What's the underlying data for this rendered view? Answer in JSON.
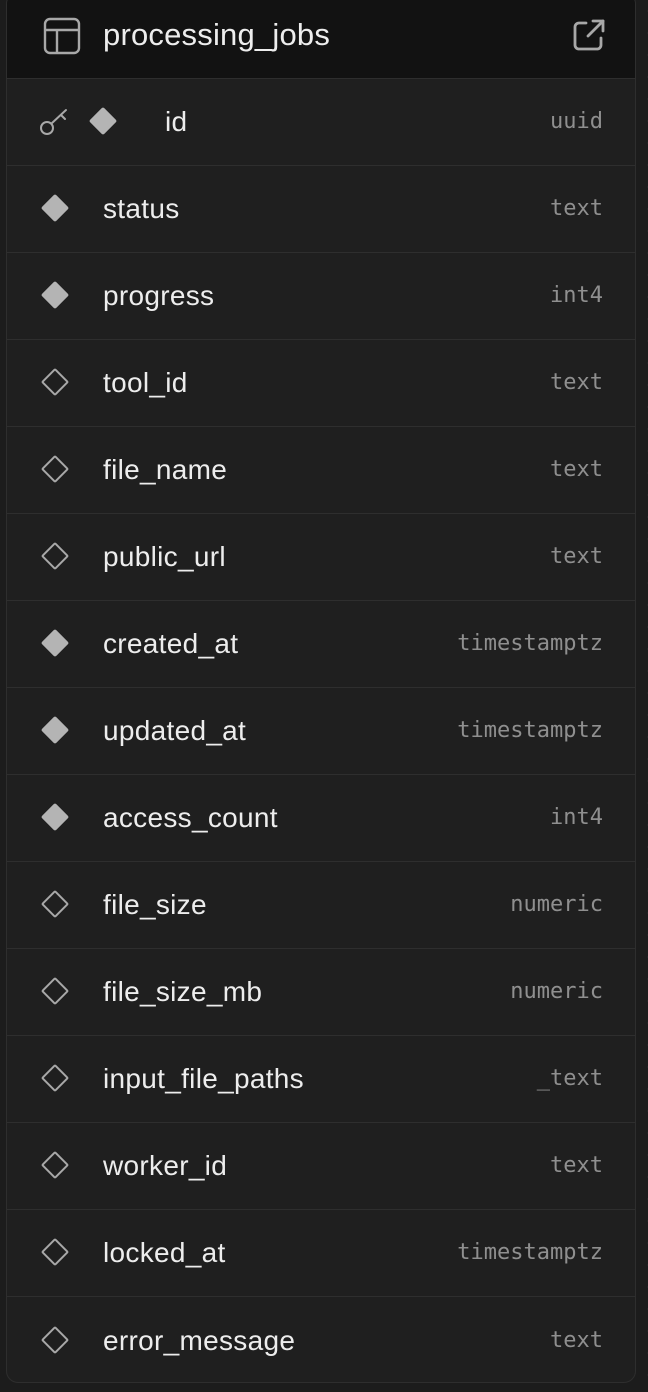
{
  "table": {
    "title": "processing_jobs",
    "icons": {
      "table": "table-icon",
      "open": "external-link-icon",
      "primary_key": "key-icon"
    },
    "columns": [
      {
        "name": "id",
        "type": "uuid",
        "primary_key": true,
        "nullable": false
      },
      {
        "name": "status",
        "type": "text",
        "primary_key": false,
        "nullable": false
      },
      {
        "name": "progress",
        "type": "int4",
        "primary_key": false,
        "nullable": false
      },
      {
        "name": "tool_id",
        "type": "text",
        "primary_key": false,
        "nullable": true
      },
      {
        "name": "file_name",
        "type": "text",
        "primary_key": false,
        "nullable": true
      },
      {
        "name": "public_url",
        "type": "text",
        "primary_key": false,
        "nullable": true
      },
      {
        "name": "created_at",
        "type": "timestamptz",
        "primary_key": false,
        "nullable": false
      },
      {
        "name": "updated_at",
        "type": "timestamptz",
        "primary_key": false,
        "nullable": false
      },
      {
        "name": "access_count",
        "type": "int4",
        "primary_key": false,
        "nullable": false
      },
      {
        "name": "file_size",
        "type": "numeric",
        "primary_key": false,
        "nullable": true
      },
      {
        "name": "file_size_mb",
        "type": "numeric",
        "primary_key": false,
        "nullable": true
      },
      {
        "name": "input_file_paths",
        "type": "_text",
        "primary_key": false,
        "nullable": true
      },
      {
        "name": "worker_id",
        "type": "text",
        "primary_key": false,
        "nullable": true
      },
      {
        "name": "locked_at",
        "type": "timestamptz",
        "primary_key": false,
        "nullable": true
      },
      {
        "name": "error_message",
        "type": "text",
        "primary_key": false,
        "nullable": true
      }
    ]
  },
  "colors": {
    "background": "#1c1c1c",
    "card": "#1f1f1f",
    "header": "#121212",
    "border": "#2e2e2e",
    "text_primary": "#ededed",
    "text_type": "#8f8f8f",
    "diamond": "#b4b4b4"
  }
}
